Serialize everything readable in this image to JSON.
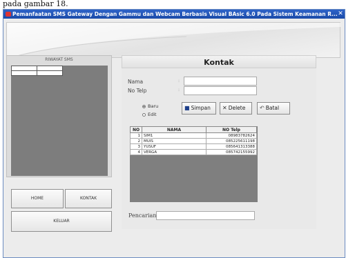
{
  "caption": "pada gambar 18.",
  "window": {
    "title": "Pemanfaatan SMS Gateway Dengan Gammu dan Webcam Berbasis Visual BAsic 6.0 Pada Sistem Keamanan R...",
    "close_symbol": "✕"
  },
  "left_panel": {
    "title": "RIWAYAT SMS"
  },
  "nav": {
    "home": "HOME",
    "kontak": "KONTAK",
    "keluar": "KELUAR"
  },
  "kontak": {
    "title": "Kontak",
    "nama_label": "Nama",
    "notelp_label": "No Telp",
    "nama_value": "",
    "notelp_value": "",
    "radio_baru": "Baru",
    "radio_edit": "Edit",
    "radio_selected": "Baru",
    "simpan": "Simpan",
    "delete": "Delete",
    "batal": "Batal"
  },
  "table": {
    "headers": [
      "NO",
      "NAMA",
      "NO Telp"
    ],
    "rows": [
      {
        "no": "1",
        "nama": "SIM1",
        "telp": "08983782624"
      },
      {
        "no": "2",
        "nama": "MUIS",
        "telp": "085225611198"
      },
      {
        "no": "3",
        "nama": "YUSUF",
        "telp": "085641313388"
      },
      {
        "no": "4",
        "nama": "VERGA",
        "telp": "085742155992"
      }
    ]
  },
  "search": {
    "label": "Pencarian",
    "value": ""
  },
  "colors": {
    "titlebar": "#1f55b8",
    "grid_bg": "#7d7d7d"
  }
}
